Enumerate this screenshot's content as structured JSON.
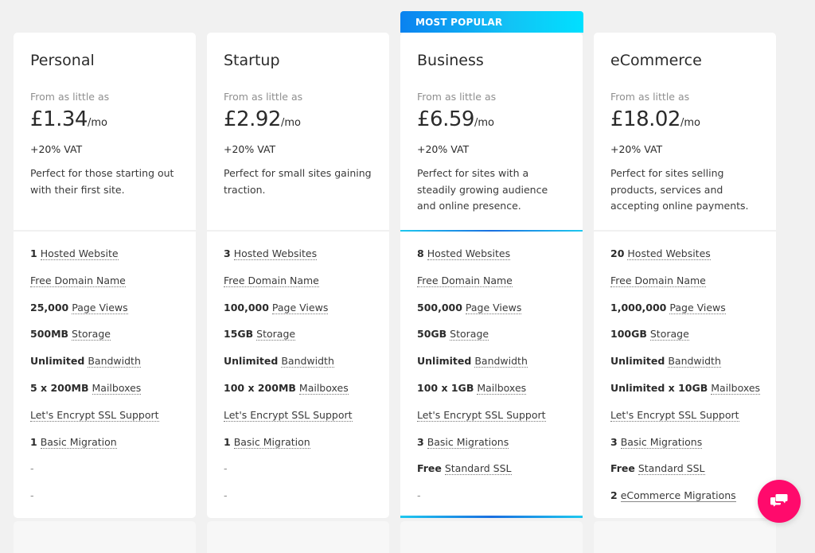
{
  "badge": {
    "label": "MOST POPULAR"
  },
  "colors": {
    "accent_pink": "#ff0a6c",
    "accent_blue": "#1a6fe0",
    "accent_cyan": "#1ec8ef"
  },
  "plans": [
    {
      "name": "Personal",
      "from_label": "From as little as",
      "price": "£1.34",
      "per": "/mo",
      "vat": "+20% VAT",
      "description": "Perfect for those starting out with their first site.",
      "features": [
        {
          "value": "1",
          "label": "Hosted Website"
        },
        {
          "value": "",
          "label": "Free Domain Name"
        },
        {
          "value": "25,000",
          "label": "Page Views"
        },
        {
          "value": "500MB",
          "label": "Storage"
        },
        {
          "value": "Unlimited",
          "label": "Bandwidth"
        },
        {
          "value": "5 x 200MB",
          "label": "Mailboxes"
        },
        {
          "value": "",
          "label": "Let's Encrypt SSL Support"
        },
        {
          "value": "1",
          "label": "Basic Migration"
        },
        {
          "value": "-",
          "label": ""
        },
        {
          "value": "-",
          "label": ""
        }
      ]
    },
    {
      "name": "Startup",
      "from_label": "From as little as",
      "price": "£2.92",
      "per": "/mo",
      "vat": "+20% VAT",
      "description": "Perfect for small sites gaining traction.",
      "features": [
        {
          "value": "3",
          "label": "Hosted Websites"
        },
        {
          "value": "",
          "label": "Free Domain Name"
        },
        {
          "value": "100,000",
          "label": "Page Views"
        },
        {
          "value": "15GB",
          "label": "Storage"
        },
        {
          "value": "Unlimited",
          "label": "Bandwidth"
        },
        {
          "value": "100 x 200MB",
          "label": "Mailboxes"
        },
        {
          "value": "",
          "label": "Let's Encrypt SSL Support"
        },
        {
          "value": "1",
          "label": "Basic Migration"
        },
        {
          "value": "-",
          "label": ""
        },
        {
          "value": "-",
          "label": ""
        }
      ]
    },
    {
      "name": "Business",
      "from_label": "From as little as",
      "price": "£6.59",
      "per": "/mo",
      "vat": "+20% VAT",
      "description": "Perfect for sites with a steadily growing audience and online presence.",
      "features": [
        {
          "value": "8",
          "label": "Hosted Websites"
        },
        {
          "value": "",
          "label": "Free Domain Name"
        },
        {
          "value": "500,000",
          "label": "Page Views"
        },
        {
          "value": "50GB",
          "label": "Storage"
        },
        {
          "value": "Unlimited",
          "label": "Bandwidth"
        },
        {
          "value": "100 x 1GB",
          "label": "Mailboxes"
        },
        {
          "value": "",
          "label": "Let's Encrypt SSL Support"
        },
        {
          "value": "3",
          "label": "Basic Migrations"
        },
        {
          "value": "Free",
          "label": "Standard SSL"
        },
        {
          "value": "-",
          "label": ""
        }
      ]
    },
    {
      "name": "eCommerce",
      "from_label": "From as little as",
      "price": "£18.02",
      "per": "/mo",
      "vat": "+20% VAT",
      "description": "Perfect for sites selling products, services and accepting online payments.",
      "features": [
        {
          "value": "20",
          "label": "Hosted Websites"
        },
        {
          "value": "",
          "label": "Free Domain Name"
        },
        {
          "value": "1,000,000",
          "label": "Page Views"
        },
        {
          "value": "100GB",
          "label": "Storage"
        },
        {
          "value": "Unlimited",
          "label": "Bandwidth"
        },
        {
          "value": "Unlimited x 10GB",
          "label": "Mailboxes"
        },
        {
          "value": "",
          "label": "Let's Encrypt SSL Support"
        },
        {
          "value": "3",
          "label": "Basic Migrations"
        },
        {
          "value": "Free",
          "label": "Standard SSL"
        },
        {
          "value": "2",
          "label": "eCommerce Migrations"
        }
      ]
    }
  ],
  "chat": {
    "icon": "chat-bubbles-icon"
  }
}
